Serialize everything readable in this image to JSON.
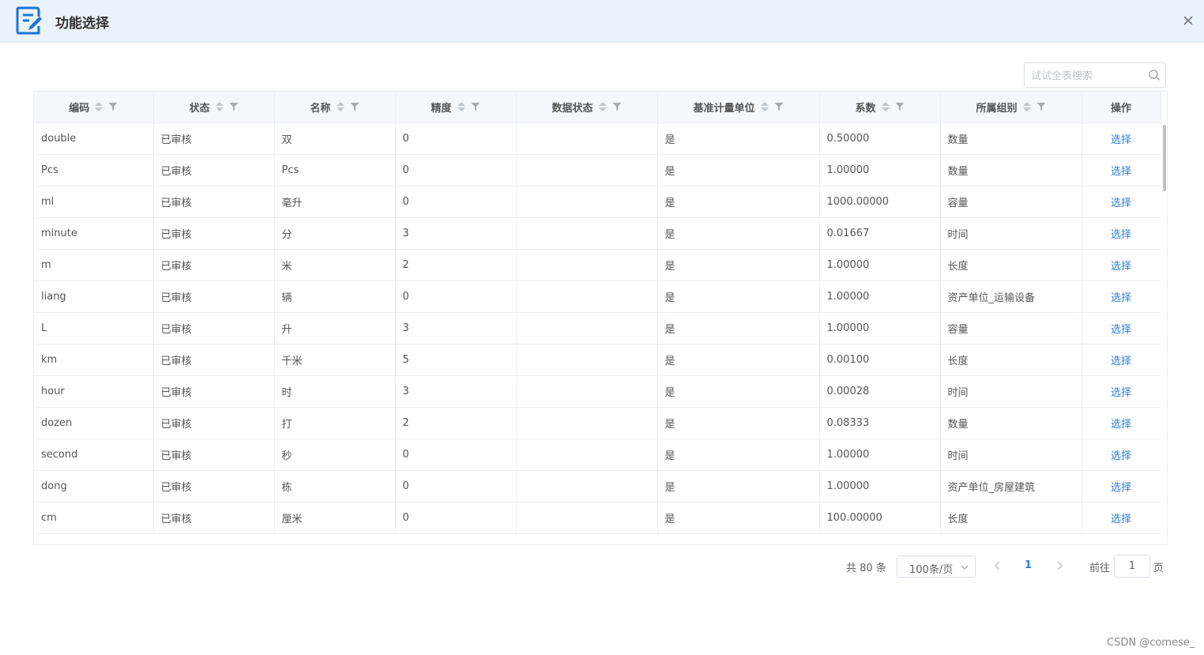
{
  "dialog": {
    "title": "功能选择",
    "accent_color": "#1a73d9"
  },
  "search": {
    "placeholder": "试试全表搜索"
  },
  "table": {
    "columns": [
      {
        "label": "编码",
        "sortable": true,
        "filterable": true
      },
      {
        "label": "状态",
        "sortable": true,
        "filterable": true
      },
      {
        "label": "名称",
        "sortable": true,
        "filterable": true
      },
      {
        "label": "精度",
        "sortable": true,
        "filterable": true
      },
      {
        "label": "数据状态",
        "sortable": true,
        "filterable": true
      },
      {
        "label": "基准计量单位",
        "sortable": true,
        "filterable": true
      },
      {
        "label": "系数",
        "sortable": true,
        "filterable": true
      },
      {
        "label": "所属组别",
        "sortable": true,
        "filterable": true
      },
      {
        "label": "操作",
        "sortable": false,
        "filterable": false
      }
    ],
    "rows": [
      [
        "double",
        "已审核",
        "双",
        "0",
        "",
        "是",
        "0.50000",
        "数量",
        "选择"
      ],
      [
        "Pcs",
        "已审核",
        "Pcs",
        "0",
        "",
        "是",
        "1.00000",
        "数量",
        "选择"
      ],
      [
        "ml",
        "已审核",
        "毫升",
        "0",
        "",
        "是",
        "1000.00000",
        "容量",
        "选择"
      ],
      [
        "minute",
        "已审核",
        "分",
        "3",
        "",
        "是",
        "0.01667",
        "时间",
        "选择"
      ],
      [
        "m",
        "已审核",
        "米",
        "2",
        "",
        "是",
        "1.00000",
        "长度",
        "选择"
      ],
      [
        "liang",
        "已审核",
        "辆",
        "0",
        "",
        "是",
        "1.00000",
        "资产单位_运输设备",
        "选择"
      ],
      [
        "L",
        "已审核",
        "升",
        "3",
        "",
        "是",
        "1.00000",
        "容量",
        "选择"
      ],
      [
        "km",
        "已审核",
        "千米",
        "5",
        "",
        "是",
        "0.00100",
        "长度",
        "选择"
      ],
      [
        "hour",
        "已审核",
        "时",
        "3",
        "",
        "是",
        "0.00028",
        "时间",
        "选择"
      ],
      [
        "dozen",
        "已审核",
        "打",
        "2",
        "",
        "是",
        "0.08333",
        "数量",
        "选择"
      ],
      [
        "second",
        "已审核",
        "秒",
        "0",
        "",
        "是",
        "1.00000",
        "时间",
        "选择"
      ],
      [
        "dong",
        "已审核",
        "栋",
        "0",
        "",
        "是",
        "1.00000",
        "资产单位_房屋建筑",
        "选择"
      ],
      [
        "cm",
        "已审核",
        "厘米",
        "0",
        "",
        "是",
        "100.00000",
        "长度",
        "选择"
      ]
    ]
  },
  "pagination": {
    "total": "共 80 条",
    "page_size": "100条/页",
    "current_page": "1",
    "goto_label": "前往",
    "goto_value": "1",
    "goto_suffix": "页"
  },
  "watermark": "CSDN @comese_"
}
